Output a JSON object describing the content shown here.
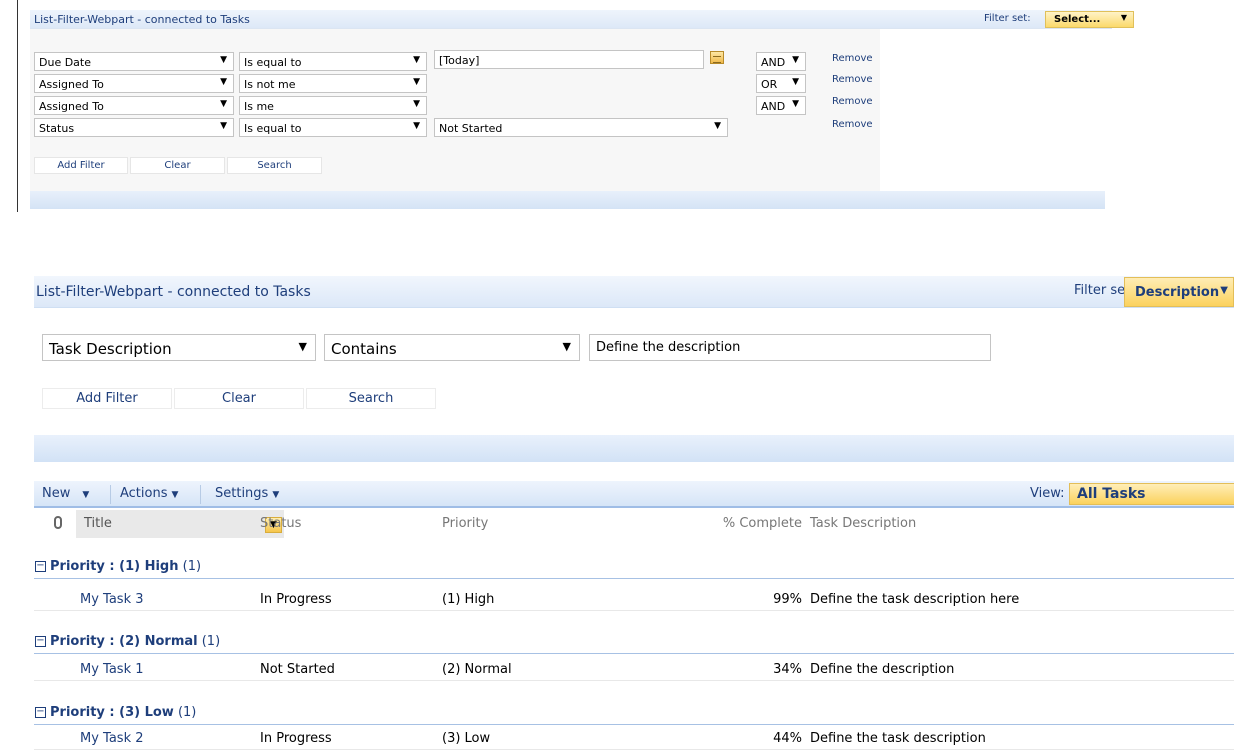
{
  "top_webpart": {
    "title": "List-Filter-Webpart - connected to Tasks",
    "filter_set_label": "Filter set:",
    "filter_set_value": "Select...",
    "filters": [
      {
        "field": "Due Date",
        "operator": "Is equal to",
        "value": "[Today]",
        "conjunction": "AND",
        "remove": "Remove"
      },
      {
        "field": "Assigned To",
        "operator": "Is not me",
        "value": "",
        "conjunction": "OR",
        "remove": "Remove"
      },
      {
        "field": "Assigned To",
        "operator": "Is me",
        "value": "",
        "conjunction": "AND",
        "remove": "Remove"
      },
      {
        "field": "Status",
        "operator": "Is equal to",
        "value": "Not Started",
        "conjunction": "",
        "remove": "Remove"
      }
    ],
    "buttons": {
      "add_filter": "Add Filter",
      "clear": "Clear",
      "search": "Search"
    }
  },
  "main_webpart": {
    "title": "List-Filter-Webpart - connected to Tasks",
    "filter_set_label": "Filter set:",
    "filter_set_value": "Description",
    "filter": {
      "field": "Task Description",
      "operator": "Contains",
      "value": "Define the description"
    },
    "buttons": {
      "add_filter": "Add Filter",
      "clear": "Clear",
      "search": "Search"
    }
  },
  "toolbar": {
    "new": "New",
    "actions": "Actions",
    "settings": "Settings",
    "view_label": "View:",
    "view_value": "All Tasks"
  },
  "list": {
    "columns": {
      "title": "Title",
      "status": "Status",
      "priority": "Priority",
      "pct": "% Complete",
      "desc": "Task Description"
    },
    "groups": [
      {
        "label_prefix": "Priority : ",
        "label_value": "(1) High",
        "count": "(1)",
        "rows": [
          {
            "title": "My Task 3",
            "status": "In Progress",
            "priority": "(1) High",
            "pct": "99%",
            "desc": "Define the task description here"
          }
        ]
      },
      {
        "label_prefix": "Priority : ",
        "label_value": "(2) Normal",
        "count": "(1)",
        "rows": [
          {
            "title": "My Task 1",
            "status": "Not Started",
            "priority": "(2) Normal",
            "pct": "34%",
            "desc": "Define the description"
          }
        ]
      },
      {
        "label_prefix": "Priority : ",
        "label_value": "(3) Low",
        "count": "(1)",
        "rows": [
          {
            "title": "My Task 2",
            "status": "In Progress",
            "priority": "(3) Low",
            "pct": "44%",
            "desc": "Define the task description"
          }
        ]
      }
    ]
  }
}
